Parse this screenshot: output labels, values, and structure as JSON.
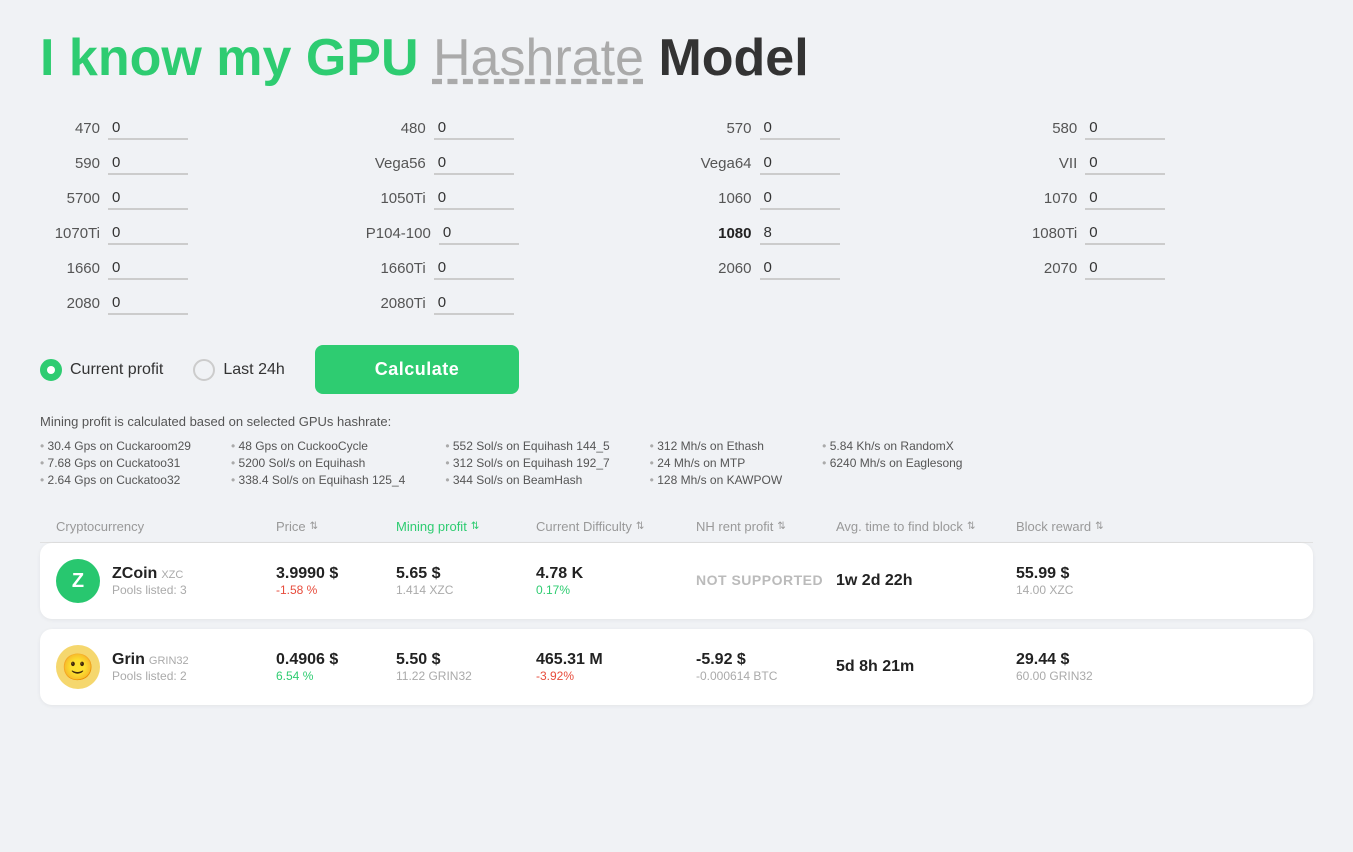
{
  "title": {
    "part1": "I know my GPU",
    "part2": "Hashrate",
    "part3": "Model"
  },
  "gpu_fields": [
    {
      "label": "470",
      "value": "0",
      "bold": false
    },
    {
      "label": "480",
      "value": "0",
      "bold": false
    },
    {
      "label": "570",
      "value": "0",
      "bold": false
    },
    {
      "label": "580",
      "value": "0",
      "bold": false
    },
    {
      "label": "590",
      "value": "0",
      "bold": false
    },
    {
      "label": "Vega56",
      "value": "0",
      "bold": false
    },
    {
      "label": "Vega64",
      "value": "0",
      "bold": false
    },
    {
      "label": "VII",
      "value": "0",
      "bold": false
    },
    {
      "label": "5700",
      "value": "0",
      "bold": false
    },
    {
      "label": "1050Ti",
      "value": "0",
      "bold": false
    },
    {
      "label": "1060",
      "value": "0",
      "bold": false
    },
    {
      "label": "1070",
      "value": "0",
      "bold": false
    },
    {
      "label": "1070Ti",
      "value": "0",
      "bold": false
    },
    {
      "label": "P104-100",
      "value": "0",
      "bold": false
    },
    {
      "label": "1080",
      "value": "8",
      "bold": true
    },
    {
      "label": "1080Ti",
      "value": "0",
      "bold": false
    },
    {
      "label": "1660",
      "value": "0",
      "bold": false
    },
    {
      "label": "1660Ti",
      "value": "0",
      "bold": false
    },
    {
      "label": "2060",
      "value": "0",
      "bold": false
    },
    {
      "label": "2070",
      "value": "0",
      "bold": false
    },
    {
      "label": "2080",
      "value": "0",
      "bold": false
    },
    {
      "label": "2080Ti",
      "value": "0",
      "bold": false
    }
  ],
  "controls": {
    "current_profit_label": "Current profit",
    "last_24h_label": "Last 24h",
    "calculate_label": "Calculate"
  },
  "info": {
    "text": "Mining profit is calculated based on selected GPUs hashrate:",
    "bullets": [
      [
        "30.4 Gps on Cuckaroom29",
        "7.68 Gps on Cuckatoo31",
        "2.64 Gps on Cuckatoo32"
      ],
      [
        "48 Gps on CuckooCycle",
        "5200 Sol/s on Equihash",
        "338.4 Sol/s on Equihash 125_4"
      ],
      [
        "552 Sol/s on Equihash 144_5",
        "312 Sol/s on Equihash 192_7",
        "344 Sol/s on BeamHash"
      ],
      [
        "312 Mh/s on Ethash",
        "24 Mh/s on MTP",
        "128 Mh/s on KAWPOW"
      ],
      [
        "5.84 Kh/s on RandomX",
        "6240 Mh/s on Eaglesong"
      ]
    ]
  },
  "table": {
    "headers": [
      {
        "label": "Cryptocurrency",
        "sortable": false,
        "active": false
      },
      {
        "label": "Price",
        "sortable": true,
        "active": false
      },
      {
        "label": "Mining profit",
        "sortable": true,
        "active": true
      },
      {
        "label": "Current Difficulty",
        "sortable": true,
        "active": false
      },
      {
        "label": "NH rent profit",
        "sortable": true,
        "active": false
      },
      {
        "label": "Avg. time to find block",
        "sortable": true,
        "active": false
      },
      {
        "label": "Block reward",
        "sortable": true,
        "active": false
      }
    ],
    "rows": [
      {
        "logo_type": "zcoin",
        "logo_text": "Z",
        "name": "ZCoin",
        "ticker": "XZC",
        "algo": "",
        "pools": "Pools listed: 3",
        "price": "3.9990 $",
        "price_change": "-1.58 %",
        "price_change_dir": "down",
        "profit": "5.65 $",
        "profit_sub": "1.414 XZC",
        "difficulty": "4.78 K",
        "difficulty_change": "0.17%",
        "difficulty_change_dir": "up",
        "nh_profit": "NOT SUPPORTED",
        "nh_not_supported": true,
        "time": "1w 2d 22h",
        "reward": "55.99 $",
        "reward_sub": "14.00 XZC"
      },
      {
        "logo_type": "grin",
        "logo_text": "😊",
        "name": "Grin",
        "ticker": "",
        "algo": "GRIN32",
        "pools": "Pools listed: 2",
        "price": "0.4906 $",
        "price_change": "6.54 %",
        "price_change_dir": "up",
        "profit": "5.50 $",
        "profit_sub": "11.22 GRIN32",
        "difficulty": "465.31 M",
        "difficulty_change": "-3.92%",
        "difficulty_change_dir": "down",
        "nh_profit": "-5.92 $",
        "nh_profit_sub": "-0.000614 BTC",
        "nh_not_supported": false,
        "time": "5d 8h 21m",
        "reward": "29.44 $",
        "reward_sub": "60.00 GRIN32"
      }
    ]
  }
}
